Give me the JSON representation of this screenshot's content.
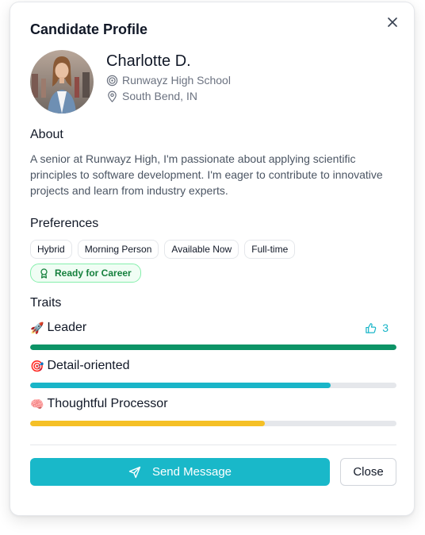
{
  "dialog": {
    "title": "Candidate Profile",
    "close_icon": "close-icon"
  },
  "candidate": {
    "name": "Charlotte D.",
    "school": "Runwayz High School",
    "school_icon": "target-icon",
    "location": "South Bend, IN",
    "location_icon": "map-pin-icon"
  },
  "about": {
    "heading": "About",
    "text": "A senior at Runwayz High, I'm passionate about applying scientific principles to software development. I'm eager to contribute to innovative projects and learn from industry experts."
  },
  "preferences": {
    "heading": "Preferences",
    "chips": [
      "Hybrid",
      "Morning Person",
      "Available Now",
      "Full-time"
    ],
    "badge": {
      "label": "Ready for Career",
      "icon": "award-icon",
      "color": "#15803d"
    }
  },
  "traits": {
    "heading": "Traits",
    "likes": {
      "count": "3",
      "icon": "thumbs-up-icon"
    },
    "items": [
      {
        "emoji": "🚀",
        "label": "Leader",
        "level": 1.0,
        "color": "#0c9366"
      },
      {
        "emoji": "🎯",
        "label": "Detail-oriented",
        "level": 0.82,
        "color": "#19b5c8"
      },
      {
        "emoji": "🧠",
        "label": "Thoughtful Processor",
        "level": 0.64,
        "color": "#f5c026"
      }
    ]
  },
  "actions": {
    "send_label": "Send Message",
    "send_icon": "send-icon",
    "close_label": "Close"
  },
  "colors": {
    "accent": "#19b8c9",
    "badge_bg": "#f0fdf4"
  }
}
